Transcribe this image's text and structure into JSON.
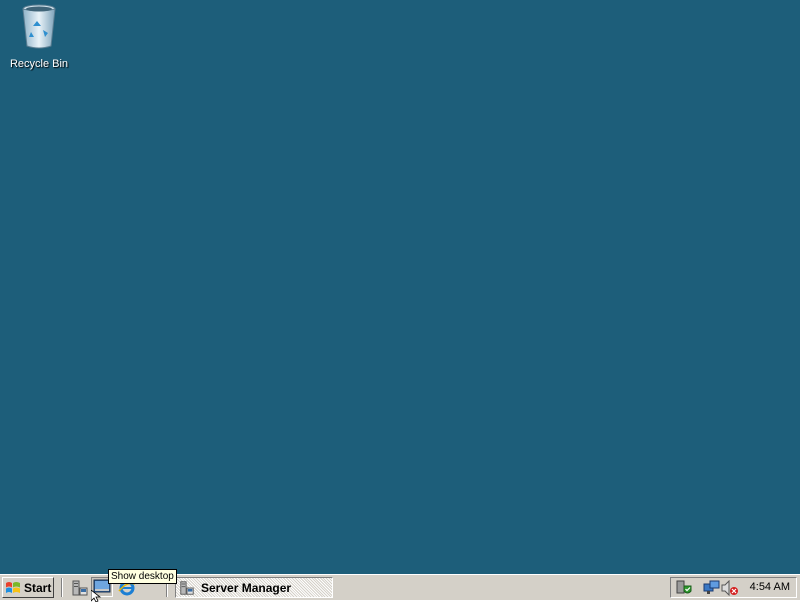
{
  "desktop": {
    "background_color": "#1d5e7a",
    "icons": [
      {
        "label": "Recycle Bin",
        "icon": "recycle-bin-icon"
      }
    ]
  },
  "taskbar": {
    "start_label": "Start",
    "quick_launch": [
      {
        "icon": "server-manager-icon",
        "tooltip": ""
      },
      {
        "icon": "show-desktop-icon",
        "tooltip": "Show desktop"
      },
      {
        "icon": "internet-explorer-icon",
        "tooltip": ""
      }
    ],
    "tasks": [
      {
        "label": "Server Manager",
        "icon": "server-manager-icon",
        "active": true
      }
    ],
    "tray": {
      "icons": [
        "security-shield-icon",
        "network-icon",
        "volume-muted-icon"
      ],
      "clock": "4:54 AM"
    }
  },
  "tooltip": {
    "text": "Show desktop"
  }
}
